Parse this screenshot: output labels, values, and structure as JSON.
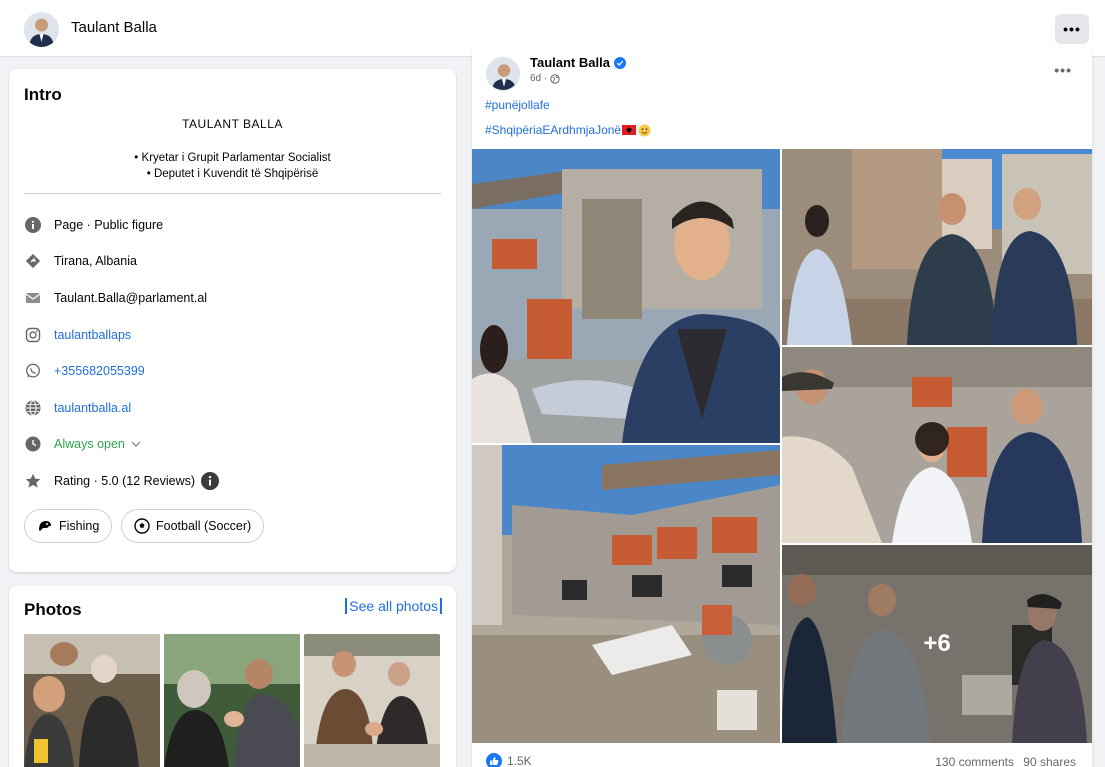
{
  "header": {
    "name": "Taulant Balla",
    "more_label": "•••"
  },
  "intro": {
    "title": "Intro",
    "bio_name": "TAULANT BALLA",
    "bio_lines": [
      "• Kryetar i Grupit Parlamentar Socialist",
      "• Deputet i Kuvendit të Shqipërisë"
    ],
    "info": {
      "category": "Page · Public figure",
      "location": "Tirana, Albania",
      "email": "Taulant.Balla@parlament.al",
      "instagram": "taulantballaps",
      "whatsapp": "+355682055399",
      "website": "taulantballa.al",
      "hours": "Always open",
      "rating": "Rating · 5.0 (12 Reviews)"
    },
    "interests": [
      "Fishing",
      "Football (Soccer)"
    ]
  },
  "photos": {
    "title": "Photos",
    "see_all": "See all photos"
  },
  "post": {
    "author": "Taulant Balla",
    "time": "6d ·",
    "hashtags": [
      "#punëjollafe",
      "#ShqipëriaEArdhmjaJonë"
    ],
    "more_count": "+6",
    "reactions": "1.5K",
    "comments": "130 comments",
    "shares": "90 shares"
  },
  "colors": {
    "link": "#216fdb",
    "open": "#31a24c",
    "brand": "#1877f2"
  }
}
